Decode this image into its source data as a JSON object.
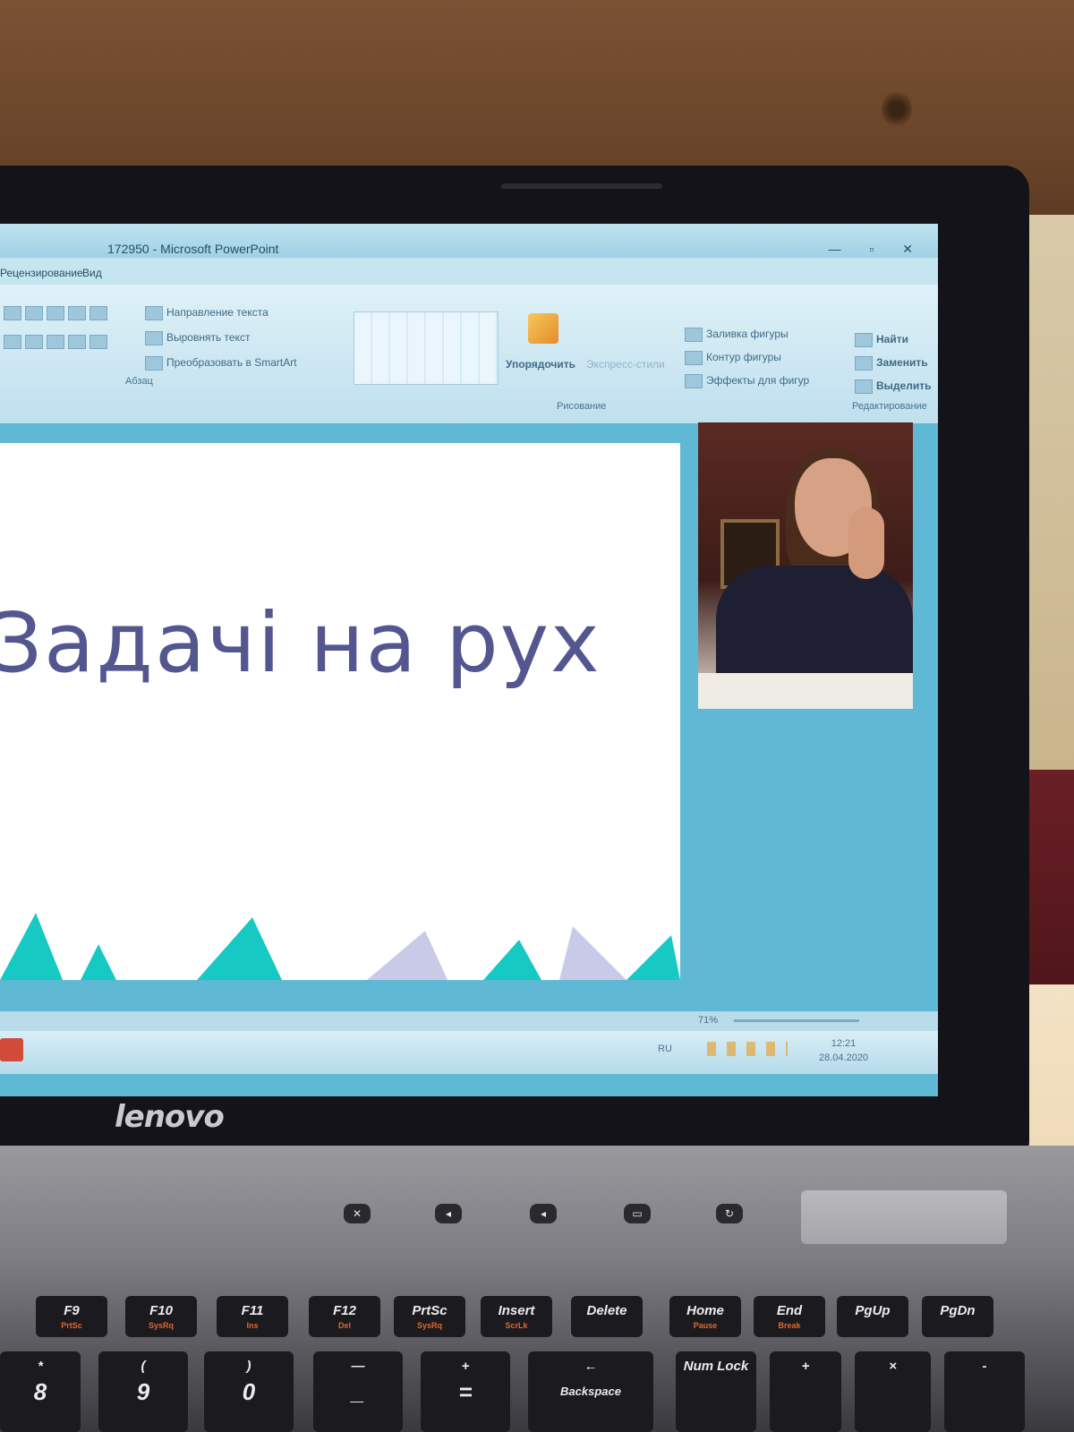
{
  "window": {
    "title": "172950 - Microsoft PowerPoint",
    "controls": "— ▫ ✕"
  },
  "tabs": [
    "Рецензирование",
    "Вид"
  ],
  "ribbon": {
    "paragraph": {
      "label": "Абзац",
      "items": [
        "Направление текста",
        "Выровнять текст",
        "Преобразовать в SmartArt"
      ]
    },
    "drawing": {
      "label": "Рисование",
      "arrange": "Упорядочить",
      "quick_styles": "Экспресс-стили",
      "items": [
        "Заливка фигуры",
        "Контур фигуры",
        "Эффекты для фигур"
      ]
    },
    "editing": {
      "label": "Редактирование",
      "items": [
        "Найти",
        "Заменить",
        "Выделить"
      ]
    }
  },
  "slide": {
    "title": "Задачі на рух"
  },
  "status": {
    "zoom": "71%"
  },
  "taskbar": {
    "lang": "RU",
    "time": "12:21",
    "date": "28.04.2020"
  },
  "laptop": {
    "brand": "lenovo",
    "keys": [
      {
        "main": "F9",
        "sub": "PrtSc"
      },
      {
        "main": "F10",
        "sub": "SysRq"
      },
      {
        "main": "F11",
        "sub": "Ins"
      },
      {
        "main": "F12",
        "sub": "Del"
      },
      {
        "main": "PrtSc",
        "sub": "SysRq"
      },
      {
        "main": "Insert",
        "sub": "ScrLk"
      },
      {
        "main": "Delete",
        "sub": ""
      },
      {
        "main": "Home",
        "sub": "Pause"
      },
      {
        "main": "End",
        "sub": "Break"
      },
      {
        "main": "PgUp",
        "sub": ""
      },
      {
        "main": "PgDn",
        "sub": ""
      }
    ],
    "row2": [
      "*",
      "(",
      ")",
      "—",
      "+",
      "←",
      "Num Lock",
      "+",
      "×",
      "-"
    ],
    "row3": [
      "8",
      "9",
      "0",
      "_",
      "=",
      "Backspace"
    ]
  },
  "colors": {
    "slide_title": "#54578f",
    "accent_triangles": "#17c9c3",
    "window_bg": "#5fb8d4"
  }
}
